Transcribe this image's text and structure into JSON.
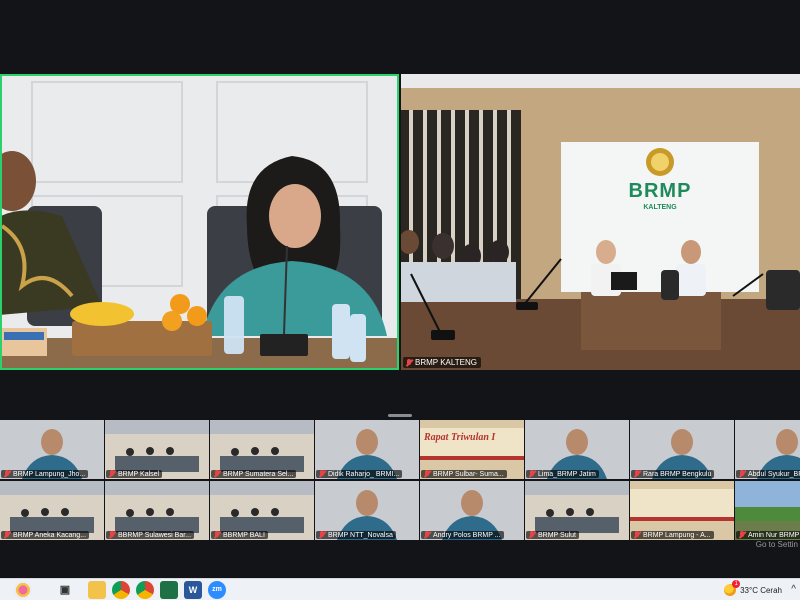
{
  "app": "Zoom Meeting",
  "main_tiles": [
    {
      "id": "left",
      "name": ""
    },
    {
      "id": "right",
      "name": "BRMP KALTENG",
      "muted": true,
      "banner_title": "BRMP",
      "banner_subtitle": "KALTENG"
    }
  ],
  "gallery": [
    {
      "name": "BRMP Lampung_Jho...",
      "scene": "person"
    },
    {
      "name": "BRMP Kalsel",
      "scene": "room"
    },
    {
      "name": "BRMP Sumatera Sel...",
      "scene": "room"
    },
    {
      "name": "Didik Raharjo_ BRMI...",
      "scene": "person"
    },
    {
      "name": "BRMP Sulbar- Suma...",
      "scene": "banner",
      "banner": "Rapat Triwulan I"
    },
    {
      "name": "Lima_BRMP Jatim",
      "scene": "person"
    },
    {
      "name": "Rara BRMP Bengkulu",
      "scene": "person"
    },
    {
      "name": "Abdul Syukur_BRMP...",
      "scene": "person"
    },
    {
      "name": "BRMP Aneka Kacang...",
      "scene": "room"
    },
    {
      "name": "BBRMP Sulawesi Bar...",
      "scene": "room"
    },
    {
      "name": "BBRMP BALI",
      "scene": "room"
    },
    {
      "name": "BRMP NTT_Novalsa",
      "scene": "person"
    },
    {
      "name": "Andry Polos BRMP ...",
      "scene": "person"
    },
    {
      "name": "BRMP Sulut",
      "scene": "room"
    },
    {
      "name": "BRMP Lampung - A...",
      "scene": "banner",
      "banner": ""
    },
    {
      "name": "Amin Nur BRMP Pap...",
      "scene": "outdoor"
    }
  ],
  "go_to_settings": "Go to Settin",
  "taskbar": {
    "apps": [
      {
        "name": "zoom-app",
        "label": "zm",
        "color": "#2d8cff"
      },
      {
        "name": "word-app",
        "label": "W",
        "color": "#2b579a"
      }
    ],
    "weather": "33°C  Cerah",
    "chevron": "^"
  },
  "colors": {
    "active_speaker": "#2bd16c",
    "brand_green": "#1f8a5b"
  }
}
